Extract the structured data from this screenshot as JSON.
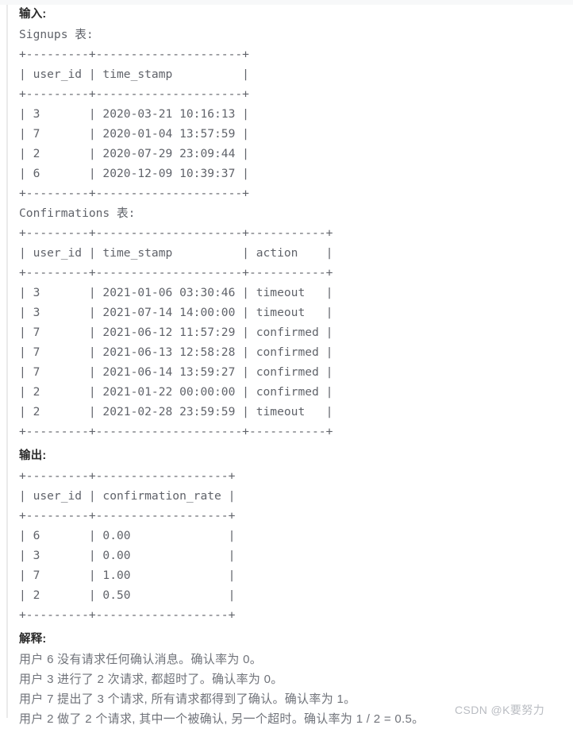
{
  "sections": {
    "input": {
      "heading": "输入:",
      "signups_caption": "Signups 表:",
      "signups_table": "+---------+---------------------+\n| user_id | time_stamp          |\n+---------+---------------------+\n| 3       | 2020-03-21 10:16:13 |\n| 7       | 2020-01-04 13:57:59 |\n| 2       | 2020-07-29 23:09:44 |\n| 6       | 2020-12-09 10:39:37 |\n+---------+---------------------+",
      "confirmations_caption": "Confirmations 表:",
      "confirmations_table": "+---------+---------------------+-----------+\n| user_id | time_stamp          | action    |\n+---------+---------------------+-----------+\n| 3       | 2021-01-06 03:30:46 | timeout   |\n| 3       | 2021-07-14 14:00:00 | timeout   |\n| 7       | 2021-06-12 11:57:29 | confirmed |\n| 7       | 2021-06-13 12:58:28 | confirmed |\n| 7       | 2021-06-14 13:59:27 | confirmed |\n| 2       | 2021-01-22 00:00:00 | confirmed |\n| 2       | 2021-02-28 23:59:59 | timeout   |\n+---------+---------------------+-----------+"
    },
    "output": {
      "heading": "输出:",
      "table": "+---------+-------------------+\n| user_id | confirmation_rate |\n+---------+-------------------+\n| 6       | 0.00              |\n| 3       | 0.00              |\n| 7       | 1.00              |\n| 2       | 0.50              |\n+---------+-------------------+"
    },
    "explanation": {
      "heading": "解释:",
      "lines": [
        "用户 6 没有请求任何确认消息。确认率为 0。",
        "用户 3 进行了 2 次请求, 都超时了。确认率为 0。",
        "用户 7 提出了 3 个请求, 所有请求都得到了确认。确认率为 1。",
        "用户 2 做了 2 个请求, 其中一个被确认, 另一个超时。确认率为 1 / 2 = 0.5。"
      ]
    }
  },
  "watermark": {
    "text": "CSDN @K要努力"
  },
  "tables_data": {
    "signups": {
      "columns": [
        "user_id",
        "time_stamp"
      ],
      "rows": [
        [
          "3",
          "2020-03-21 10:16:13"
        ],
        [
          "7",
          "2020-01-04 13:57:59"
        ],
        [
          "2",
          "2020-07-29 23:09:44"
        ],
        [
          "6",
          "2020-12-09 10:39:37"
        ]
      ]
    },
    "confirmations": {
      "columns": [
        "user_id",
        "time_stamp",
        "action"
      ],
      "rows": [
        [
          "3",
          "2021-01-06 03:30:46",
          "timeout"
        ],
        [
          "3",
          "2021-07-14 14:00:00",
          "timeout"
        ],
        [
          "7",
          "2021-06-12 11:57:29",
          "confirmed"
        ],
        [
          "7",
          "2021-06-13 12:58:28",
          "confirmed"
        ],
        [
          "7",
          "2021-06-14 13:59:27",
          "confirmed"
        ],
        [
          "2",
          "2021-01-22 00:00:00",
          "confirmed"
        ],
        [
          "2",
          "2021-02-28 23:59:59",
          "timeout"
        ]
      ]
    },
    "result": {
      "columns": [
        "user_id",
        "confirmation_rate"
      ],
      "rows": [
        [
          "6",
          "0.00"
        ],
        [
          "3",
          "0.00"
        ],
        [
          "7",
          "1.00"
        ],
        [
          "2",
          "0.50"
        ]
      ]
    }
  }
}
